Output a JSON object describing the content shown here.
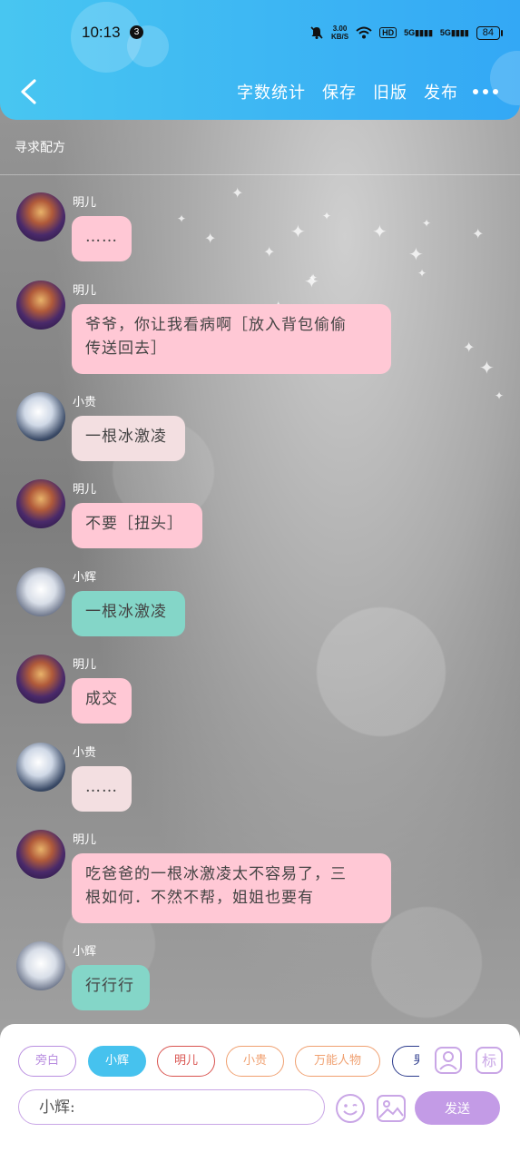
{
  "status_bar": {
    "time": "10:13",
    "notification_count": "3",
    "net_speed_value": "3.00",
    "net_speed_unit": "KB/S",
    "hd": "HD",
    "signal1": "5G",
    "signal2": "5G",
    "battery": "84"
  },
  "header": {
    "actions": [
      "字数统计",
      "保存",
      "旧版",
      "发布"
    ],
    "colors": {
      "start": "#48c6f1",
      "end": "#33a8f5"
    }
  },
  "chat_title": "寻求配方",
  "messages": [
    {
      "sender": "明儿",
      "avatar": "avatar-mingr",
      "text": "……",
      "style": "pink"
    },
    {
      "sender": "明儿",
      "avatar": "avatar-mingr",
      "text": "爷爷，你让我看病啊［放入背包偷偷\n传送回去］",
      "style": "pink"
    },
    {
      "sender": "小贵",
      "avatar": "avatar-xiaogui",
      "text": "一根冰激凌",
      "style": "light"
    },
    {
      "sender": "明儿",
      "avatar": "avatar-mingr",
      "text": "不要［扭头］",
      "style": "pink"
    },
    {
      "sender": "小辉",
      "avatar": "avatar-xiaohui",
      "text": "一根冰激凌",
      "style": "teal"
    },
    {
      "sender": "明儿",
      "avatar": "avatar-mingr",
      "text": "成交",
      "style": "pink"
    },
    {
      "sender": "小贵",
      "avatar": "avatar-xiaogui",
      "text": "……",
      "style": "light"
    },
    {
      "sender": "明儿",
      "avatar": "avatar-mingr",
      "text": "吃爸爸的一根冰激凌太不容易了，三\n根如何．不然不帮，姐姐也要有",
      "style": "pink"
    },
    {
      "sender": "小辉",
      "avatar": "avatar-xiaohui",
      "text": "行行行",
      "style": "teal"
    }
  ],
  "bubble_colors": {
    "pink": "#ffc8d5",
    "light": "#f3dfe1",
    "teal": "#84d6c8"
  },
  "composer": {
    "roles": [
      {
        "label": "旁白",
        "color": "#b98ee0",
        "active": false
      },
      {
        "label": "小辉",
        "color": "#46c2ee",
        "active": true
      },
      {
        "label": "明儿",
        "color": "#d9534f",
        "active": false
      },
      {
        "label": "小贵",
        "color": "#f0a070",
        "active": false
      },
      {
        "label": "万能人物",
        "color": "#f0a070",
        "active": false
      },
      {
        "label": "男",
        "color": "#2b3a8c",
        "active": false
      }
    ],
    "icons": [
      "person-icon",
      "tag-icon",
      "emoji-icon",
      "image-icon"
    ],
    "tag_char": "标",
    "input_placeholder": "小辉:",
    "send_label": "发送",
    "accent": "#c39be6"
  }
}
